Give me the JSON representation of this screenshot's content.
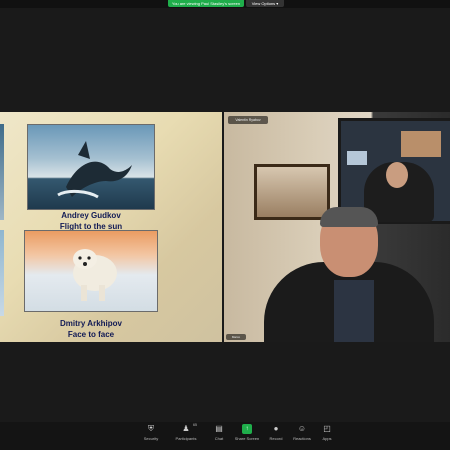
{
  "banner": {
    "text": "You are viewing Paul Stasiley's screen"
  },
  "view_options": {
    "label": "View Options ▾"
  },
  "shared_screen": {
    "slides": [
      {
        "artist": "Andrey Gudkov",
        "title": "Flight to the sun"
      },
      {
        "artist": "Dmitry Arkhipov",
        "title": "Face to face"
      }
    ]
  },
  "video": {
    "top_name": "Valentin Ryabov",
    "bottom_name": "Marco"
  },
  "toolbar": {
    "participants_count": "65",
    "items": [
      {
        "label": "Security",
        "icon": "shield-icon",
        "glyph": "⛨"
      },
      {
        "label": "Participants",
        "icon": "people-icon",
        "glyph": "♟"
      },
      {
        "label": "Chat",
        "icon": "chat-icon",
        "glyph": "▤"
      },
      {
        "label": "Share Screen",
        "icon": "share-screen-icon",
        "glyph": "↑"
      },
      {
        "label": "Record",
        "icon": "record-icon",
        "glyph": "●"
      },
      {
        "label": "Reactions",
        "icon": "reactions-icon",
        "glyph": "☺"
      },
      {
        "label": "Apps",
        "icon": "apps-icon",
        "glyph": "◰"
      }
    ]
  }
}
